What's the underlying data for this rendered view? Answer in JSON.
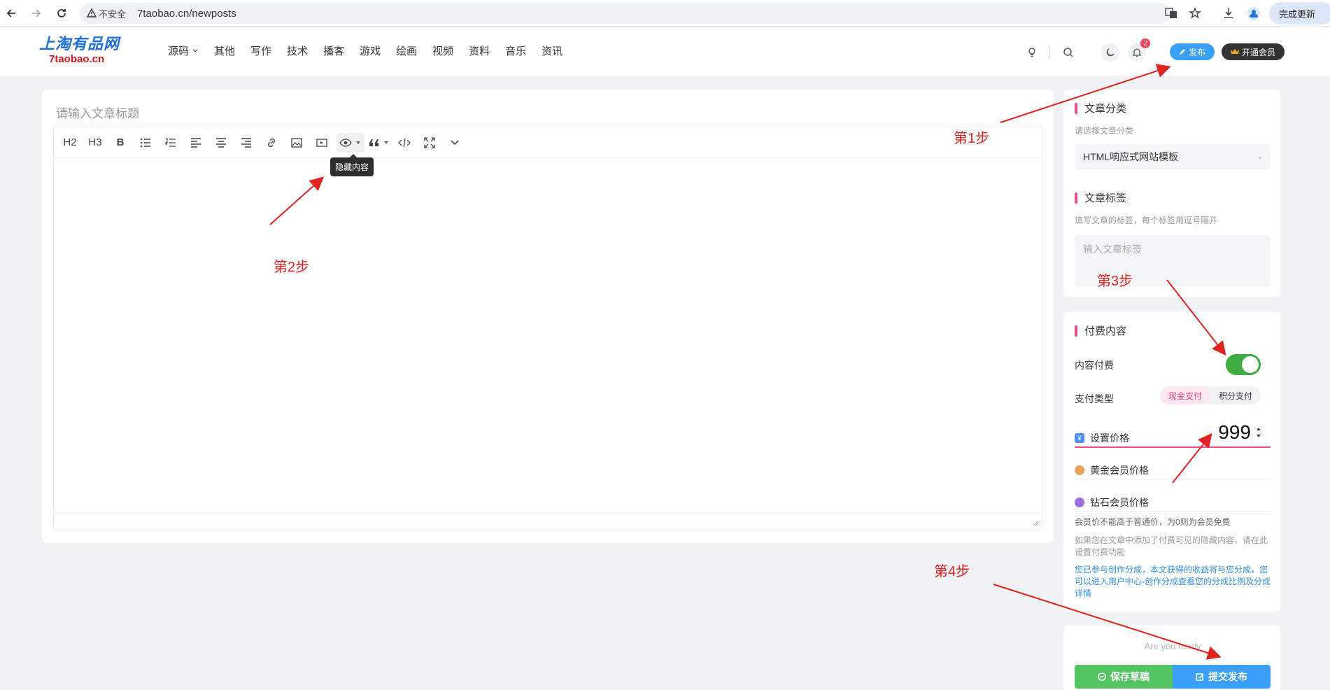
{
  "browser": {
    "security_label": "不安全",
    "url": "7taobao.cn/newposts",
    "update_label": "完成更新"
  },
  "site": {
    "logo_cn": "上淘有品网",
    "logo_domain": "7taobao.cn",
    "nav": [
      "源码",
      "其他",
      "写作",
      "技术",
      "播客",
      "游戏",
      "绘画",
      "视频",
      "资料",
      "音乐",
      "资讯"
    ],
    "notification_count": "2",
    "publish_label": "发布",
    "vip_label": "开通会员"
  },
  "editor": {
    "title_placeholder": "请输入文章标题",
    "toolbar": {
      "h2": "H2",
      "h3": "H3",
      "bold": "B"
    },
    "tooltip": "隐藏内容"
  },
  "sidebar": {
    "category": {
      "heading": "文章分类",
      "hint": "请选择文章分类",
      "value": "HTML响应式网站模板"
    },
    "tags": {
      "heading": "文章标签",
      "hint": "填写文章的标签，每个标签用逗号隔开",
      "placeholder": "输入文章标签"
    },
    "paid": {
      "heading": "付费内容",
      "toggle_label": "内容付费",
      "toggle_on": true,
      "pay_type_label": "支付类型",
      "pay_options": [
        "现金支付",
        "积分支付"
      ],
      "price_label": "设置价格",
      "price_value": "999",
      "gold_label": "黄金会员价格",
      "diamond_label": "钻石会员价格",
      "note1": "会员价不能高于普通价，为0则为会员免费",
      "note2": "如果您在文章中添加了付费可见的隐藏内容，请在此设置付费功能",
      "note3": "您已参与创作分成，本文获得的收益将与您分成，您可以进入用户中心-创作分成查看您的分成比例及分成详情"
    },
    "submit": {
      "ready_text": "Are you ready",
      "draft_label": "保存草稿",
      "submit_label": "提交发布"
    }
  },
  "annotations": {
    "step1": "第1步",
    "step2": "第2步",
    "step3": "第3步",
    "step4": "第4步"
  },
  "colors": {
    "accent": "#ec4c8c",
    "publish_blue": "#3aa0f7",
    "toggle_green": "#3dae3f",
    "annotation_red": "#e0231f"
  }
}
